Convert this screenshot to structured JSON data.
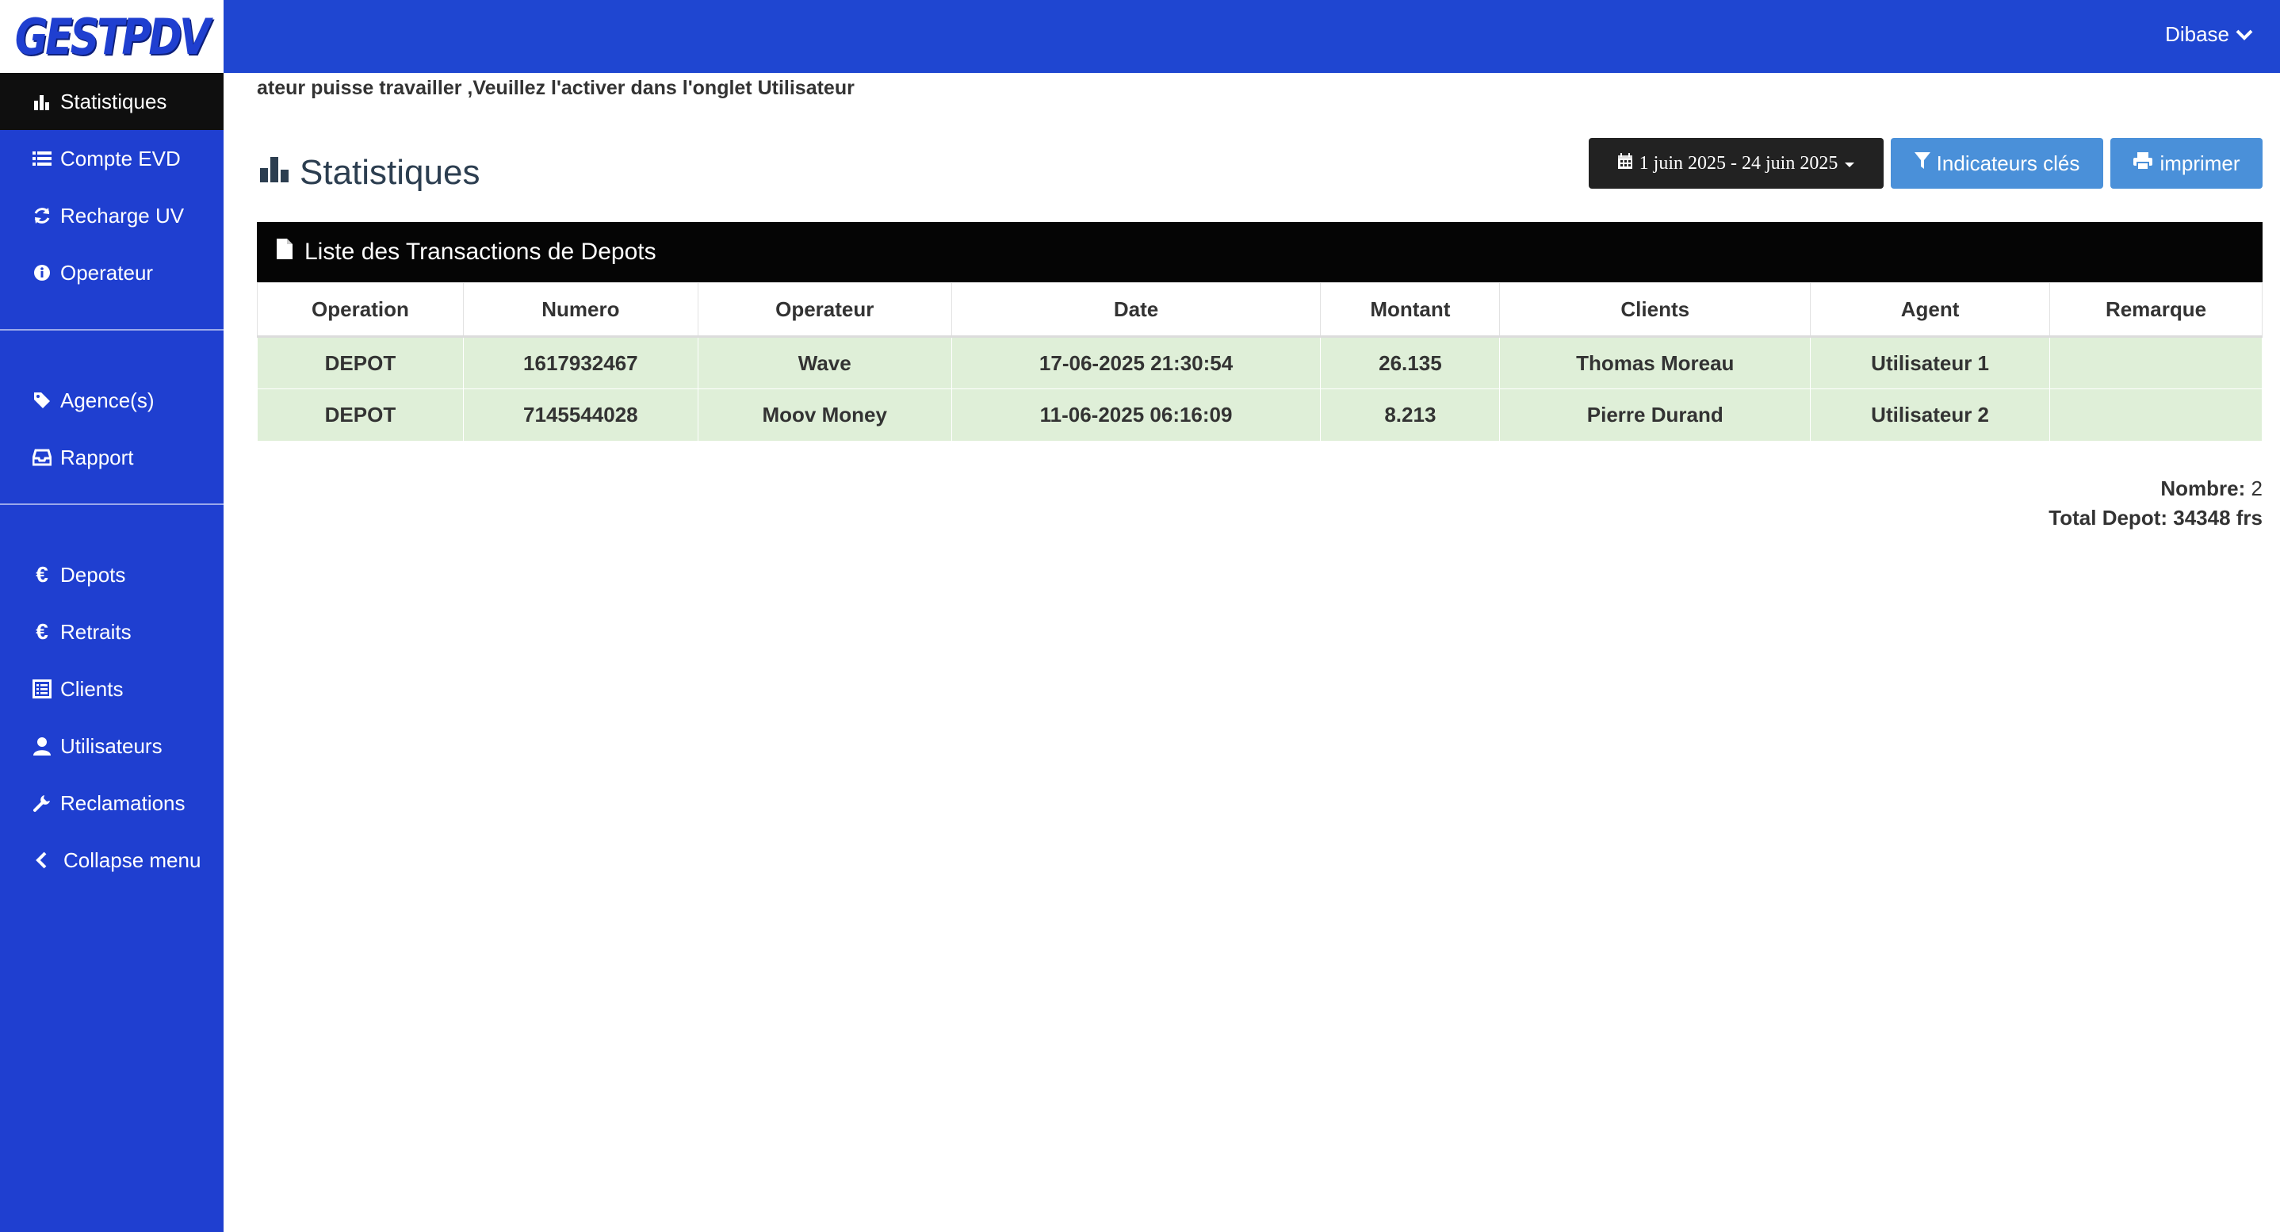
{
  "app": {
    "logo_text": "GESTPDV"
  },
  "sidebar": {
    "items": [
      {
        "label": "Statistiques",
        "icon": "bar-chart-icon"
      },
      {
        "label": "Compte EVD",
        "icon": "list-icon"
      },
      {
        "label": "Recharge UV",
        "icon": "refresh-icon"
      },
      {
        "label": "Operateur",
        "icon": "info-icon"
      },
      {
        "label": "Agence(s)",
        "icon": "tag-icon"
      },
      {
        "label": "Rapport",
        "icon": "inbox-icon"
      },
      {
        "label": "Depots",
        "icon": "euro-icon"
      },
      {
        "label": "Retraits",
        "icon": "euro-icon"
      },
      {
        "label": "Clients",
        "icon": "list-alt-icon"
      },
      {
        "label": "Utilisateurs",
        "icon": "user-icon"
      },
      {
        "label": "Reclamations",
        "icon": "wrench-icon"
      },
      {
        "label": "Collapse menu",
        "icon": "chevron-left-icon"
      }
    ]
  },
  "header": {
    "user_name": "Dibase"
  },
  "notice": "ateur puisse travailler ,Veuillez l'activer dans l'onglet Utilisateur",
  "page": {
    "title": "Statistiques",
    "date_range": "1 juin 2025 - 24 juin 2025",
    "indicators_label": "Indicateurs clés",
    "print_label": "imprimer"
  },
  "panel": {
    "title": "Liste des Transactions de Depots",
    "columns": [
      "Operation",
      "Numero",
      "Operateur",
      "Date",
      "Montant",
      "Clients",
      "Agent",
      "Remarque"
    ],
    "rows": [
      [
        "DEPOT",
        "1617932467",
        "Wave",
        "17-06-2025 21:30:54",
        "26.135",
        "Thomas Moreau",
        "Utilisateur 1",
        ""
      ],
      [
        "DEPOT",
        "7145544028",
        "Moov Money",
        "11-06-2025 06:16:09",
        "8.213",
        "Pierre Durand",
        "Utilisateur 2",
        ""
      ]
    ]
  },
  "totals": {
    "count_label": "Nombre:",
    "count_value": "2",
    "total_label": "Total Depot: 34348 frs"
  },
  "colors": {
    "sidebar": "#1f3fd0",
    "topbar": "#1f46d1",
    "row_bg": "#dfefd8",
    "button_blue": "#4a90d9"
  }
}
